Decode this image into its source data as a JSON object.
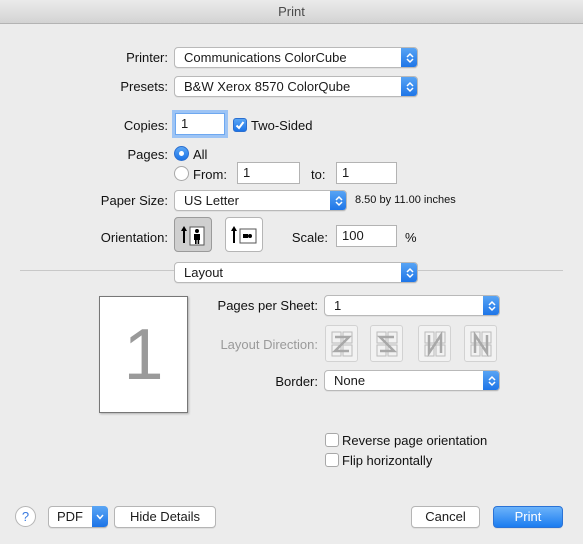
{
  "window": {
    "title": "Print"
  },
  "printer": {
    "label": "Printer:",
    "value": "Communications ColorCube"
  },
  "presets": {
    "label": "Presets:",
    "value": "B&W Xerox 8570 ColorQube"
  },
  "copies": {
    "label": "Copies:",
    "value": "1",
    "two_sided_label": "Two-Sided",
    "two_sided_checked": true
  },
  "pages": {
    "label": "Pages:",
    "all_label": "All",
    "from_label": "From:",
    "from_value": "1",
    "to_label": "to:",
    "to_value": "1"
  },
  "paper": {
    "label": "Paper Size:",
    "value": "US Letter",
    "dimensions": "8.50 by 11.00 inches"
  },
  "orientation": {
    "label": "Orientation:",
    "options": [
      "portrait-icon",
      "landscape-icon"
    ],
    "selected": "portrait"
  },
  "scale": {
    "label": "Scale:",
    "value": "100",
    "unit": "%"
  },
  "section": {
    "value": "Layout"
  },
  "layout": {
    "preview_number": "1",
    "pages_per_sheet_label": "Pages per Sheet:",
    "pages_per_sheet_value": "1",
    "direction_label": "Layout Direction:",
    "direction_icons": [
      "z-direction-icon",
      "reverse-z-direction-icon",
      "n-direction-icon",
      "reverse-n-direction-icon"
    ],
    "border_label": "Border:",
    "border_value": "None",
    "reverse_label": "Reverse page orientation",
    "flip_label": "Flip horizontally"
  },
  "footer": {
    "help": "?",
    "pdf": "PDF",
    "hide_details": "Hide Details",
    "cancel": "Cancel",
    "print": "Print"
  },
  "colors": {
    "accent": "#1b7cf0",
    "background": "#ececec"
  }
}
